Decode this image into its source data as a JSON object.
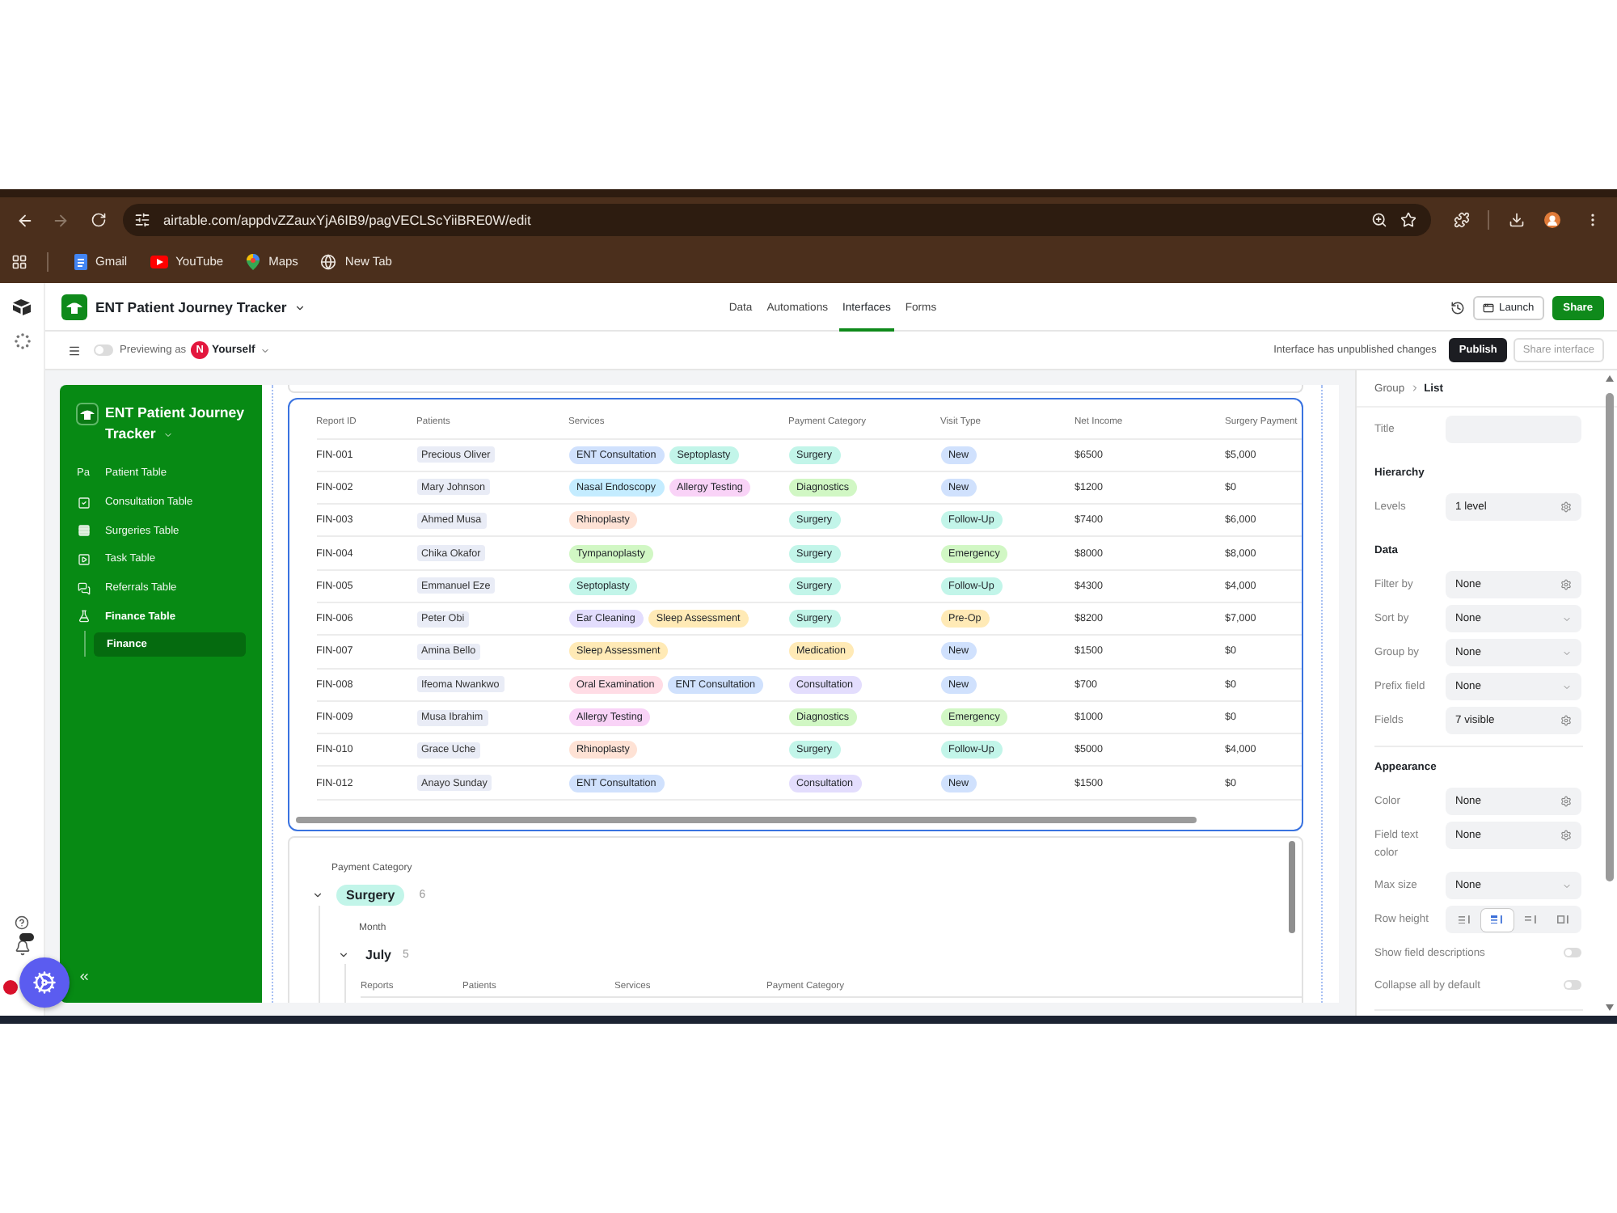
{
  "browser": {
    "url": "airtable.com/appdvZZauxYjA6IB9/pagVECLScYiiBRE0W/edit",
    "bookmarks": [
      {
        "label": "Gmail",
        "kind": "document"
      },
      {
        "label": "YouTube",
        "kind": "video"
      },
      {
        "label": "Maps",
        "kind": "map"
      },
      {
        "label": "New Tab",
        "kind": "globe"
      }
    ]
  },
  "header": {
    "title": "ENT Patient Journey Tracker",
    "nav": [
      {
        "label": "Data",
        "selected": false
      },
      {
        "label": "Automations",
        "selected": false
      },
      {
        "label": "Interfaces",
        "selected": true
      },
      {
        "label": "Forms",
        "selected": false
      }
    ],
    "buttons": [
      {
        "label": "Launch",
        "kind": "secondary"
      },
      {
        "label": "Share",
        "kind": "primary"
      }
    ]
  },
  "preview_bar": {
    "preview_toggle": {
      "on": false
    },
    "label": "Previewing as",
    "avatar_initial": "N",
    "user": "Yourself",
    "status": "Interface has unpublished changes",
    "buttons": [
      {
        "label": "Publish",
        "disabled": false
      },
      {
        "label": "Share interface",
        "disabled": true
      }
    ]
  },
  "sidebar": {
    "title": "ENT Patient Journey Tracker",
    "items": [
      {
        "label": "Patient Table",
        "kind": "text",
        "icon_text": "Pa",
        "selected": false,
        "expanded": false
      },
      {
        "label": "Consultation Table",
        "kind": "checkbox",
        "selected": false,
        "expanded": false
      },
      {
        "label": "Surgeries Table",
        "kind": "rows",
        "selected": false,
        "expanded": false
      },
      {
        "label": "Task Table",
        "kind": "square",
        "selected": false,
        "expanded": false
      },
      {
        "label": "Referrals Table",
        "kind": "chat",
        "selected": false,
        "expanded": false
      },
      {
        "label": "Finance Table",
        "kind": "flask",
        "selected": false,
        "expanded": true,
        "children": [
          {
            "label": "Finance",
            "selected": true
          }
        ]
      }
    ]
  },
  "table": {
    "columns": [
      "Report ID",
      "Patients",
      "Services",
      "Payment Category",
      "Visit Type",
      "Net Income",
      "Surgery Payment"
    ],
    "rows": [
      {
        "report_id": "FIN-001",
        "patient": "Precious Oliver",
        "services": [
          {
            "label": "ENT Consultation",
            "color": "#d0e1fd"
          },
          {
            "label": "Septoplasty",
            "color": "#c2f5e9"
          }
        ],
        "payment_category": {
          "label": "Surgery",
          "color": "#c2f5e9"
        },
        "visit_type": {
          "label": "New",
          "color": "#d0e1fd"
        },
        "net_income": "$6500",
        "surgery_payment": "$5,000"
      },
      {
        "report_id": "FIN-002",
        "patient": "Mary Johnson",
        "services": [
          {
            "label": "Nasal Endoscopy",
            "color": "#c4ecff"
          },
          {
            "label": "Allergy Testing",
            "color": "#f9d3f7"
          }
        ],
        "payment_category": {
          "label": "Diagnostics",
          "color": "#d1f7c4"
        },
        "visit_type": {
          "label": "New",
          "color": "#d0e1fd"
        },
        "net_income": "$1200",
        "surgery_payment": "$0"
      },
      {
        "report_id": "FIN-003",
        "patient": "Ahmed Musa",
        "services": [
          {
            "label": "Rhinoplasty",
            "color": "#fee2d5"
          }
        ],
        "payment_category": {
          "label": "Surgery",
          "color": "#c2f5e9"
        },
        "visit_type": {
          "label": "Follow-Up",
          "color": "#c2f5e9"
        },
        "net_income": "$7400",
        "surgery_payment": "$6,000"
      },
      {
        "report_id": "FIN-004",
        "patient": "Chika Okafor",
        "services": [
          {
            "label": "Tympanoplasty",
            "color": "#d1f7c4"
          }
        ],
        "payment_category": {
          "label": "Surgery",
          "color": "#c2f5e9"
        },
        "visit_type": {
          "label": "Emergency",
          "color": "#d1f7c4"
        },
        "net_income": "$8000",
        "surgery_payment": "$8,000"
      },
      {
        "report_id": "FIN-005",
        "patient": "Emmanuel Eze",
        "services": [
          {
            "label": "Septoplasty",
            "color": "#c2f5e9"
          }
        ],
        "payment_category": {
          "label": "Surgery",
          "color": "#c2f5e9"
        },
        "visit_type": {
          "label": "Follow-Up",
          "color": "#c2f5e9"
        },
        "net_income": "$4300",
        "surgery_payment": "$4,000"
      },
      {
        "report_id": "FIN-006",
        "patient": "Peter Obi",
        "services": [
          {
            "label": "Ear Cleaning",
            "color": "#e3ddfd"
          },
          {
            "label": "Sleep Assessment",
            "color": "#ffeab6"
          }
        ],
        "payment_category": {
          "label": "Surgery",
          "color": "#c2f5e9"
        },
        "visit_type": {
          "label": "Pre-Op",
          "color": "#ffeab6"
        },
        "net_income": "$8200",
        "surgery_payment": "$7,000"
      },
      {
        "report_id": "FIN-007",
        "patient": "Amina Bello",
        "services": [
          {
            "label": "Sleep Assessment",
            "color": "#ffeab6"
          }
        ],
        "payment_category": {
          "label": "Medication",
          "color": "#ffeab6"
        },
        "visit_type": {
          "label": "New",
          "color": "#d0e1fd"
        },
        "net_income": "$1500",
        "surgery_payment": "$0"
      },
      {
        "report_id": "FIN-008",
        "patient": "Ifeoma Nwankwo",
        "services": [
          {
            "label": "Oral Examination",
            "color": "#ffdce5"
          },
          {
            "label": "ENT Consultation",
            "color": "#d0e1fd"
          }
        ],
        "payment_category": {
          "label": "Consultation",
          "color": "#e3ddfd"
        },
        "visit_type": {
          "label": "New",
          "color": "#d0e1fd"
        },
        "net_income": "$700",
        "surgery_payment": "$0"
      },
      {
        "report_id": "FIN-009",
        "patient": "Musa Ibrahim",
        "services": [
          {
            "label": "Allergy Testing",
            "color": "#f9d3f7"
          }
        ],
        "payment_category": {
          "label": "Diagnostics",
          "color": "#d1f7c4"
        },
        "visit_type": {
          "label": "Emergency",
          "color": "#d1f7c4"
        },
        "net_income": "$1000",
        "surgery_payment": "$0"
      },
      {
        "report_id": "FIN-010",
        "patient": "Grace Uche",
        "services": [
          {
            "label": "Rhinoplasty",
            "color": "#fee2d5"
          }
        ],
        "payment_category": {
          "label": "Surgery",
          "color": "#c2f5e9"
        },
        "visit_type": {
          "label": "Follow-Up",
          "color": "#c2f5e9"
        },
        "net_income": "$5000",
        "surgery_payment": "$4,000"
      },
      {
        "report_id": "FIN-012",
        "patient": "Anayo Sunday",
        "services": [
          {
            "label": "ENT Consultation",
            "color": "#d0e1fd"
          }
        ],
        "payment_category": {
          "label": "Consultation",
          "color": "#e3ddfd"
        },
        "visit_type": {
          "label": "New",
          "color": "#d0e1fd"
        },
        "net_income": "$1500",
        "surgery_payment": "$0"
      }
    ]
  },
  "group_list": {
    "group_field": "Payment Category",
    "groups": [
      {
        "label": "Surgery",
        "color": "#c2f5e9",
        "count": "6",
        "expanded": true,
        "subgroup_field": "Month",
        "subgroups": [
          {
            "label": "July",
            "count": "5",
            "expanded": true,
            "columns": [
              "Reports",
              "Patients",
              "Services",
              "Payment Category"
            ]
          }
        ]
      }
    ]
  },
  "properties_panel": {
    "breadcrumb": [
      {
        "label": "Group",
        "current": false
      },
      {
        "label": "List",
        "current": true
      }
    ],
    "sections": [
      {
        "rows": [
          {
            "label": "Title",
            "kind": "input"
          }
        ]
      },
      {
        "heading": "Hierarchy",
        "rows": [
          {
            "label": "Levels",
            "kind": "settings",
            "value": "1 level"
          }
        ]
      },
      {
        "heading": "Data",
        "rows": [
          {
            "label": "Filter by",
            "kind": "settings",
            "value": "None"
          },
          {
            "label": "Sort by",
            "kind": "dropdown",
            "value": "None"
          },
          {
            "label": "Group by",
            "kind": "dropdown",
            "value": "None"
          },
          {
            "label": "Prefix field",
            "kind": "dropdown",
            "value": "None"
          },
          {
            "label": "Fields",
            "kind": "settings",
            "value": "7 visible"
          }
        ]
      },
      {
        "heading": "Appearance",
        "rows": [
          {
            "label": "Color",
            "kind": "settings",
            "value": "None"
          },
          {
            "label": "Field text color",
            "kind": "settings",
            "value": "None"
          },
          {
            "label": "Max size",
            "kind": "dropdown",
            "value": "None"
          },
          {
            "label": "Row height",
            "kind": "segmented",
            "options": [
              {
                "kind": "short",
                "selected": false
              },
              {
                "kind": "medium",
                "selected": true
              },
              {
                "kind": "tall",
                "selected": false
              },
              {
                "kind": "extra_tall",
                "selected": false
              }
            ]
          },
          {
            "label": "Show field descriptions",
            "kind": "toggle",
            "on": false
          },
          {
            "label": "Collapse all by default",
            "kind": "toggle",
            "on": false
          }
        ]
      }
    ]
  }
}
